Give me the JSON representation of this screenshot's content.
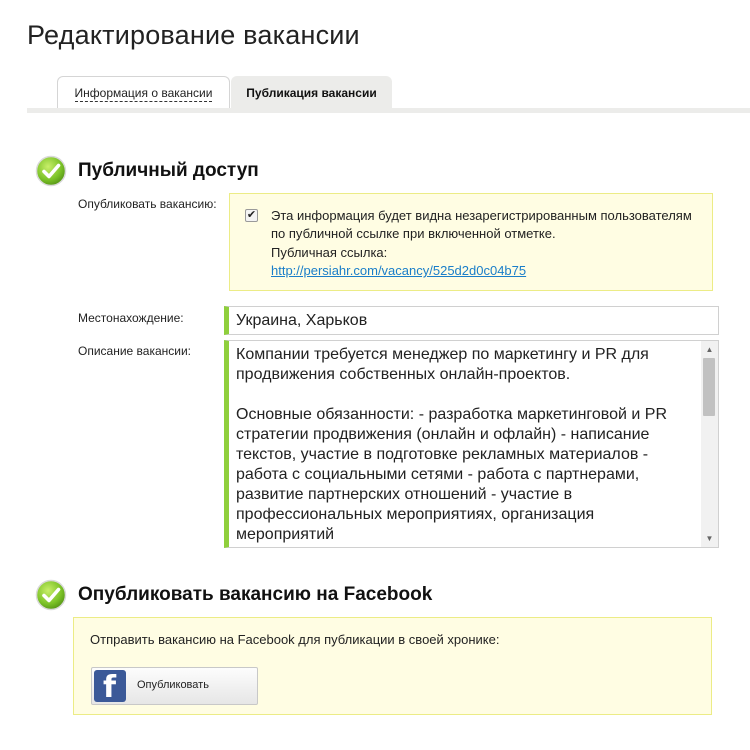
{
  "page": {
    "title": "Редактирование вакансии"
  },
  "tabs": [
    {
      "label": "Информация о вакансии",
      "active": false
    },
    {
      "label": "Публикация вакансии",
      "active": true
    }
  ],
  "public_access": {
    "title": "Публичный доступ",
    "publish_label": "Опубликовать вакансию:",
    "publish_checked": true,
    "notice": "Эта информация будет видна незарегистрированным пользователям по публичной ссылке при включенной отметке.",
    "link_label": "Публичная ссылка:",
    "link_url": "http://persiahr.com/vacancy/525d2d0c04b75"
  },
  "location": {
    "label": "Местонахождение:",
    "value": "Украина, Харьков"
  },
  "description": {
    "label": "Описание вакансии:",
    "paragraphs": [
      "Компании требуется менеджер по маркетингу и PR для продвижения собственных онлайн-проектов.",
      "Основные обязанности: - разработка маркетинговой и PR стратегии продвижения (онлайн и офлайн) - написание текстов, участие в подготовке рекламных материалов - работа с социальными сетями - работа с партнерами, развитие партнерских отношений - участие в профессиональных мероприятиях, организация мероприятий"
    ]
  },
  "facebook": {
    "title": "Опубликовать вакансию на Facebook",
    "prompt": "Отправить вакансию на Facebook для публикации в своей хронике:",
    "button_label": "Опубликовать"
  },
  "colors": {
    "accent_green": "#8fcf3c",
    "notice_bg": "#fffde3",
    "link": "#1a7ec9",
    "facebook_blue": "#3b5998"
  },
  "icons": [
    "check-circle-icon",
    "checkbox-checked-icon",
    "facebook-logo-icon",
    "scroll-up-arrow-icon",
    "scroll-down-arrow-icon"
  ]
}
